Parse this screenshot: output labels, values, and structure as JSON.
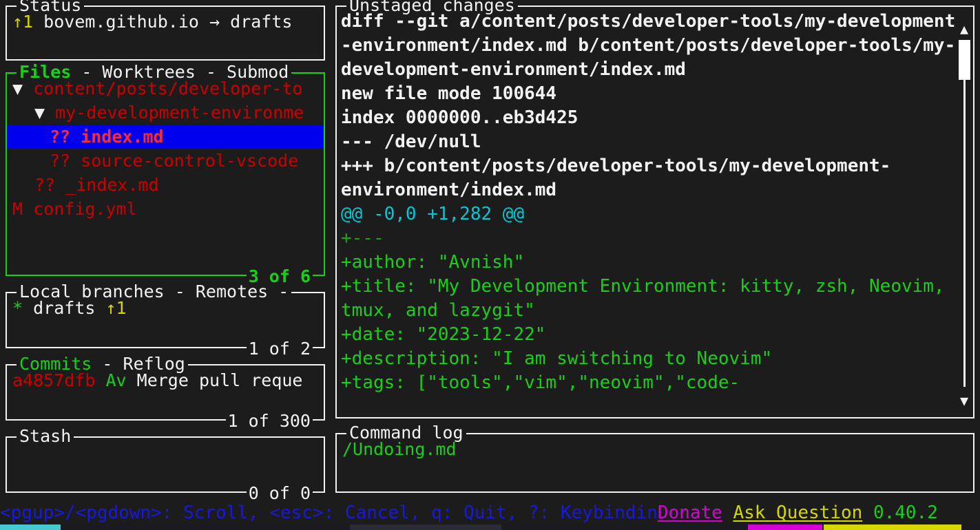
{
  "app": {
    "name": "lazygit",
    "version": "0.40.2"
  },
  "status_panel": {
    "title": "Status",
    "ahead_marker": "↑1",
    "repo": "bovem.github.io",
    "arrow": "→",
    "branch": "drafts"
  },
  "files_panel": {
    "tabs": [
      "Files",
      "Worktrees",
      "Submod"
    ],
    "tab_separator": " - ",
    "active_tab": "Files",
    "counter": "3 of 6",
    "rows": [
      {
        "collapse": "▼",
        "indent": 1,
        "status": "",
        "name": "content/posts/developer-to",
        "color": "red",
        "selected": false
      },
      {
        "collapse": "▼",
        "indent": 2,
        "status": "",
        "name": "my-development-environme",
        "color": "red",
        "selected": false
      },
      {
        "collapse": "",
        "indent": 3,
        "status": "??",
        "name": "index.md",
        "color": "red",
        "selected": true
      },
      {
        "collapse": "",
        "indent": 3,
        "status": "??",
        "name": "source-control-vscode",
        "color": "red",
        "selected": false
      },
      {
        "collapse": "",
        "indent": 2,
        "status": "??",
        "name": "_index.md",
        "color": "red",
        "selected": false
      },
      {
        "collapse": "",
        "indent": 1,
        "status": "M",
        "name": "config.yml",
        "color": "red",
        "selected": false
      }
    ]
  },
  "branches_panel": {
    "tabs": [
      "Local branches",
      "Remotes",
      ""
    ],
    "tab_separator": " - ",
    "active_tab": "Local branches",
    "counter": "1 of 2",
    "rows": [
      {
        "marker": "*",
        "name": "drafts",
        "ahead": "↑1"
      }
    ]
  },
  "commits_panel": {
    "tabs": [
      "Commits",
      "Reflog"
    ],
    "tab_separator": " - ",
    "active_tab": "Commits",
    "counter": "1 of 300",
    "rows": [
      {
        "hash": "a4857dfb",
        "author": "Av",
        "message": "Merge pull reque"
      }
    ]
  },
  "stash_panel": {
    "title": "Stash",
    "counter": "0 of 0",
    "rows": []
  },
  "diff_panel": {
    "title": "Unstaged changes",
    "lines": [
      {
        "kind": "hdr",
        "text": "diff --git a/content/posts/developer-tools/my-development"
      },
      {
        "kind": "hdr",
        "text": "-environment/index.md b/content/posts/developer-tools/my-"
      },
      {
        "kind": "hdr",
        "text": "development-environment/index.md"
      },
      {
        "kind": "hdr",
        "text": "new file mode 100644"
      },
      {
        "kind": "hdr",
        "text": "index 0000000..eb3d425"
      },
      {
        "kind": "hdr",
        "text": "--- /dev/null"
      },
      {
        "kind": "hdr",
        "text": "+++ b/content/posts/developer-tools/my-development-"
      },
      {
        "kind": "hdr",
        "text": "environment/index.md"
      },
      {
        "kind": "hunk",
        "text": "@@ -0,0 +1,282 @@"
      },
      {
        "kind": "add-dim",
        "text": "+---"
      },
      {
        "kind": "add",
        "text": "+author: \"Avnish\""
      },
      {
        "kind": "add",
        "text": "+title: \"My Development Environment: kitty, zsh, Neovim,"
      },
      {
        "kind": "add",
        "text": "tmux, and lazygit\""
      },
      {
        "kind": "add",
        "text": "+date: \"2023-12-22\""
      },
      {
        "kind": "add",
        "text": "+description: \"I am switching to Neovim\""
      },
      {
        "kind": "add",
        "text": "+tags: [\"tools\",\"vim\",\"neovim\",\"code-"
      }
    ],
    "scrollbar": {
      "up_arrow": "▲",
      "down_arrow": "▼"
    }
  },
  "command_log_panel": {
    "title": "Command log",
    "lines": [
      "/Undoing.md"
    ]
  },
  "status_line": {
    "keybindings": "<pgup>/<pgdown>: Scroll, <esc>: Cancel, q: Quit, ?: Keybindin",
    "donate": "Donate",
    "ask_question": "Ask Question",
    "version": "0.40.2"
  },
  "colors": {
    "background": "#1c1c1c",
    "foreground": "#f2f2f2",
    "active_border": "#18d018",
    "inactive_border": "#f2f2f2",
    "selection_bg": "#0000ee",
    "selection_fg": "#ff2a2a",
    "added_line": "#18d018",
    "hunk_header": "#00c8d7",
    "file_red": "#cc0000",
    "ahead_yellow": "#d7d700",
    "keybinding_blue": "#1818e0",
    "donate_magenta": "#d700d7",
    "ask_yellow": "#d7d700"
  }
}
